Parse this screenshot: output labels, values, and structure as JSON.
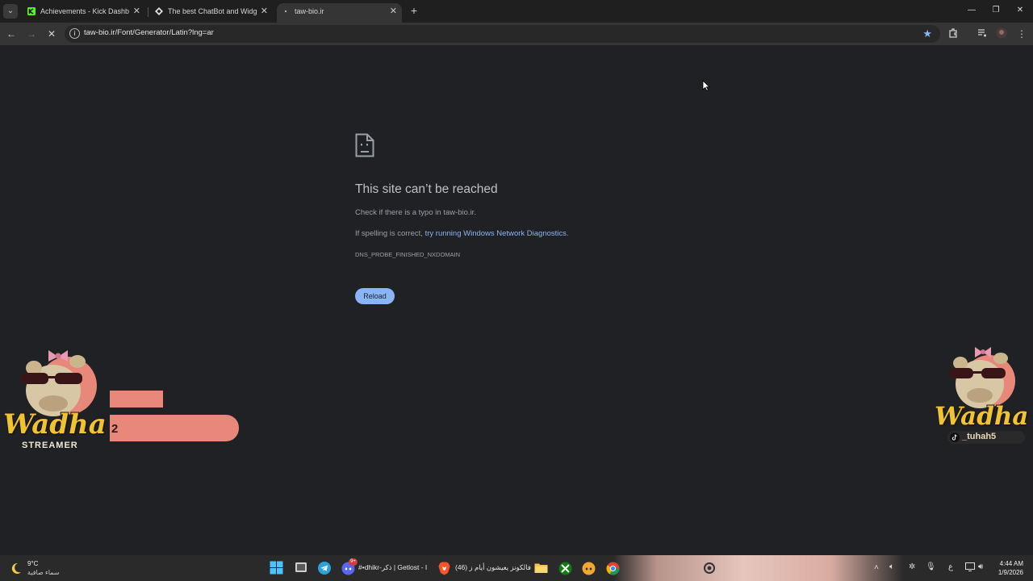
{
  "browser": {
    "tabs": [
      {
        "title": "Achievements - Kick Dashboard",
        "icon": "kick-icon",
        "active": false
      },
      {
        "title": "The best ChatBot and Widgets",
        "icon": "botrix-icon",
        "active": false
      },
      {
        "title": "taw-bio.ir",
        "icon": "loading-icon",
        "active": true
      }
    ],
    "url": "taw-bio.ir/Font/Generator/Latin?lng=ar"
  },
  "error_page": {
    "title": "This site can’t be reached",
    "line1": "Check if there is a typo in taw-bio.ir.",
    "line2_prefix": "If spelling is correct, ",
    "line2_link": "try running Windows Network Diagnostics",
    "line2_suffix": ".",
    "code": "DNS_PROBE_FINISHED_NXDOMAIN",
    "reload_label": "Reload"
  },
  "overlay": {
    "left_logo_text": "Wadha",
    "left_logo_subtitle": "STREAMER",
    "alert_number": "2",
    "right_logo_text": "Wadha",
    "right_handle": "_tuhah5"
  },
  "taskbar": {
    "weather_temp": "9°C",
    "weather_desc": "سماء صافية",
    "discord_label": "#•dhikr-ذكر | Getlost - I",
    "discord_badge": "9+",
    "brave_label": "(46) فالكونز يعيشون أيام ز",
    "input_lang": "ع",
    "time": "4:44 AM",
    "date": "1/9/2026"
  },
  "colors": {
    "page_bg": "#202124",
    "link": "#8ab4f8",
    "salmon": "#e8887a",
    "logo_gold": "#f1c232"
  }
}
